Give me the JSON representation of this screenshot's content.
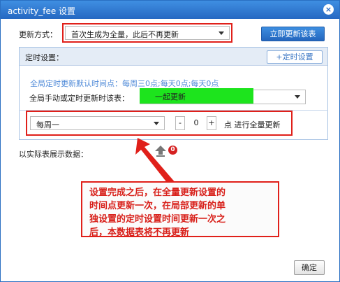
{
  "dialog": {
    "title": "activity_fee 设置",
    "close_glyph": "×"
  },
  "update_mode": {
    "label": "更新方式：",
    "selected": "首次生成为全量，此后不再更新",
    "refresh_button": "立即更新该表"
  },
  "schedule": {
    "header": "定时设置：",
    "add_button": "+定时设置",
    "default_time_text": "全局定时更新默认时间点：每周三0点;每天0点;每天0点",
    "table_label": "全局手动或定时更新时该表：",
    "table_selected": "一起更新",
    "day_selected": "每周一",
    "hour_minus": "-",
    "hour_value": "0",
    "hour_plus": "+",
    "hour_suffix": "点 进行全量更新"
  },
  "display": {
    "label": "以实际表展示数据：",
    "badge_count": "0"
  },
  "annotation": {
    "lines": [
      "设置完成之后，在全量更新设置的",
      "时间点更新一次，在局部更新的单",
      "独设置的定时设置时间更新一次之",
      "后，本数据表将不再更新"
    ]
  },
  "footer": {
    "ok_button": "确定"
  },
  "colors": {
    "title_bar": "#2a6fc2",
    "annotation_red": "#e0201a",
    "highlight_green": "#1de41d",
    "link_blue": "#4f8ad8"
  },
  "icons": {
    "close": "close-icon",
    "upload": "upload-icon",
    "dropdown": "chevron-down-icon"
  }
}
